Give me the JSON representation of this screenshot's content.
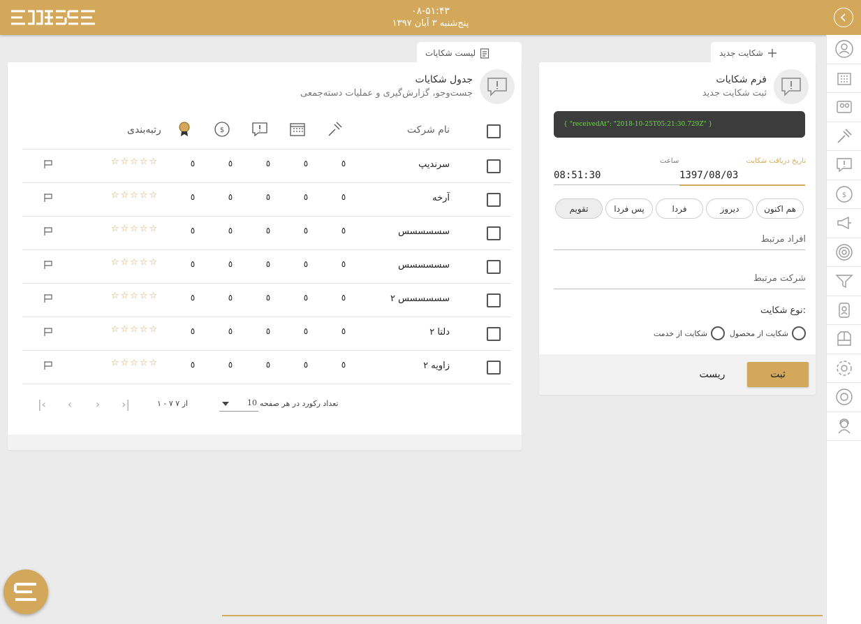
{
  "header": {
    "time": "۰۸-۵۱:۴۳",
    "date": "پنج‌شنبه ۳ آبان ۱۳۹۷"
  },
  "form_tab": {
    "label": "شکایت جدید"
  },
  "list_tab": {
    "label": "لیست شکایات"
  },
  "form": {
    "title": "فرم شکایات",
    "subtitle": "ثبت شکایت جدید",
    "code": "{ \"receivedAt\": \"2018-10-25T05:21:30.729Z\" }",
    "date_label": "تاریخ دریافت شکایت",
    "date_value": "1397/08/03",
    "time_label": "ساعت",
    "time_value": "08:51:30",
    "quick_dates": [
      "هم اکنون",
      "دیروز",
      "فردا",
      "پس فردا",
      "تقویم"
    ],
    "people_placeholder": "افراد مرتبط",
    "company_placeholder": "شرکت مرتبط",
    "type_label": "نوع شکایت:",
    "type_options": [
      "شکایت از محصول",
      "شکایت از خدمت"
    ],
    "submit_label": "ثبت",
    "reset_label": "ریست"
  },
  "table": {
    "title": "جدول شکایات",
    "subtitle": "جست‌وجو، گزارش‌گیری و عملیات دسته‌جمعی",
    "col_name": "نام شرکت",
    "col_rating": "رتبه‌بندی",
    "zero": "٥",
    "stars": "☆☆☆☆☆",
    "rows": [
      "سرندیپ",
      "آرخه",
      "سسسسسس",
      "سسسسسس",
      "سسسسسس ۲",
      "دلتا ۲",
      "زاویه ۲"
    ]
  },
  "pager": {
    "per_page_label": "تعداد رکورد در هر صفحه",
    "per_page_value": "10",
    "range": "۱ - ۷ از ۷"
  },
  "colors": {
    "accent": "#d4a85a",
    "code_bg": "#3c3c3c",
    "code_text": "#6ddc44"
  }
}
